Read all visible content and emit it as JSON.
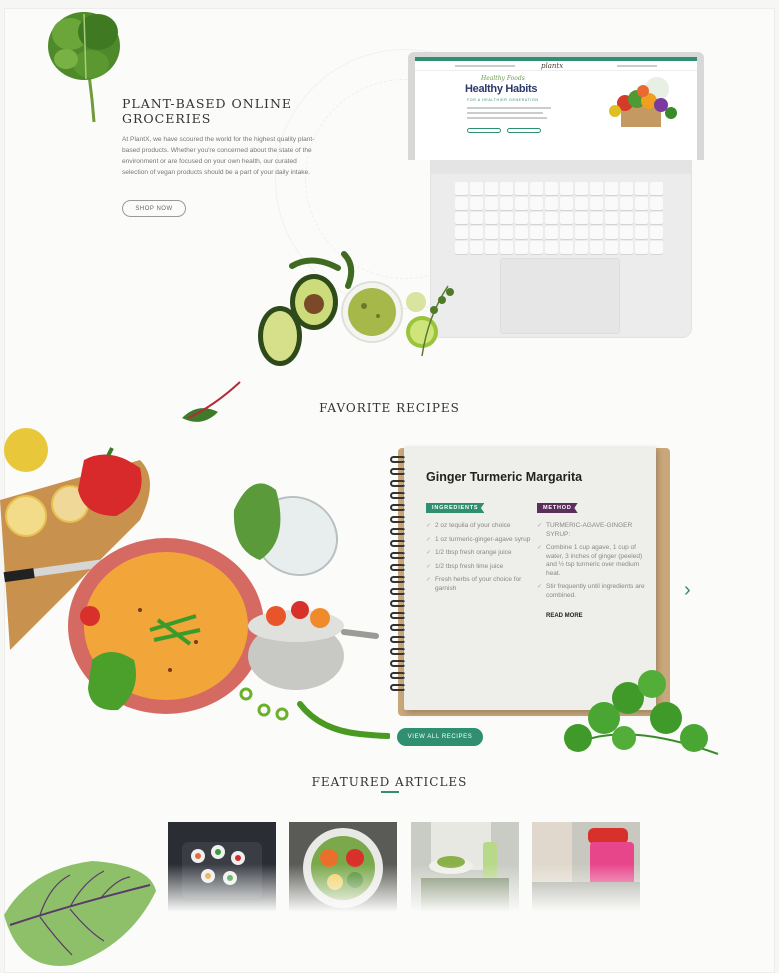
{
  "hero": {
    "title": "PLANT-BASED ONLINE GROCERIES",
    "body": "At PlantX, we have scoured the world for the highest quality plant-based products. Whether you're concerned about the state of the environment or are focused on your own health, our curated selection of vegan products should be a part of your daily intake.",
    "button_label": "SHOP NOW"
  },
  "laptop": {
    "logo": "plantx",
    "kicker": "Healthy Foods",
    "title": "Healthy Habits",
    "subtitle": "FOR A HEALTHIER GENERATION"
  },
  "recipes": {
    "section_title": "FAVORITE RECIPES",
    "card_title": "Ginger Turmeric Margarita",
    "ingredients_label": "INGREDIENTS",
    "method_label": "METHOD",
    "ingredients": [
      "2 oz tequila of your choice",
      "1 oz turmeric-ginger-agave syrup",
      "1/2 tbsp fresh orange juice",
      "1/2 tbsp fresh lime juice",
      "Fresh herbs of your choice for garnish"
    ],
    "method": [
      "TURMERIC-AGAVE-GINGER SYRUP:",
      "Combine 1 cup agave, 1 cup of water, 3 inches of ginger (peeled) and ½ tsp turmeric over medium heat.",
      "Stir frequently until ingredients are combined."
    ],
    "read_more": "READ MORE",
    "view_all": "VIEW ALL RECIPES",
    "next_icon": "chevron-right-icon"
  },
  "articles": {
    "section_title": "FEATURED ARTICLES",
    "count": 4
  },
  "colors": {
    "accent": "#2f8f70",
    "method_tag": "#5a2f5c"
  }
}
